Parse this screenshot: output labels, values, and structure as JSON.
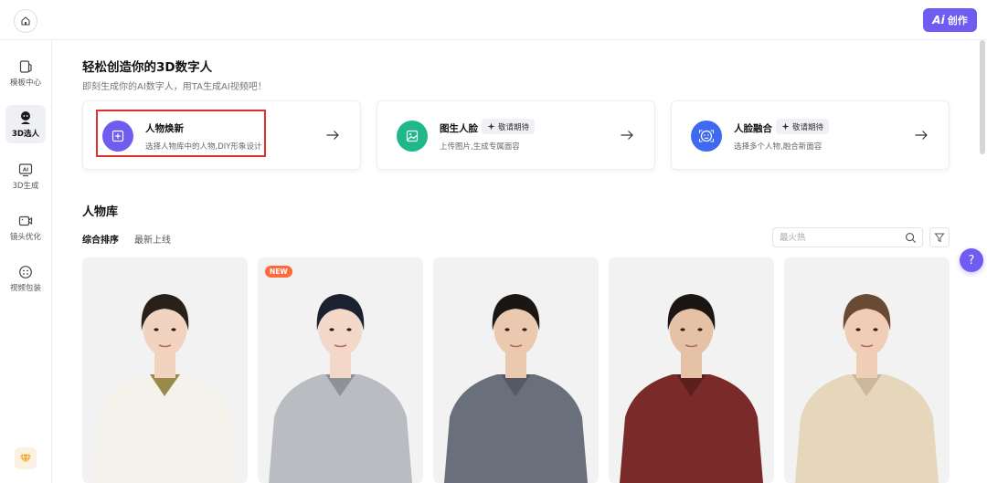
{
  "topbar": {
    "create_label": "创作",
    "create_ai": "Ai"
  },
  "sidebar": {
    "items": [
      {
        "label": "模板中心",
        "icon": "template-icon"
      },
      {
        "label": "3D选人",
        "icon": "person-icon",
        "active": true
      },
      {
        "label": "3D生成",
        "icon": "ai-generate-icon"
      },
      {
        "label": "镜头优化",
        "icon": "camera-icon"
      },
      {
        "label": "视频包装",
        "icon": "package-icon"
      }
    ],
    "bottom_icon": "diamond-icon"
  },
  "header": {
    "title": "轻松创造你的3D数字人",
    "subtitle": "即刻生成你的AI数字人，用TA生成AI视频吧！"
  },
  "features": [
    {
      "title": "人物焕新",
      "desc": "选择人物库中的人物,DIY形象设计",
      "icon": "plus-square-icon",
      "color": "#6f5cf0",
      "badge": ""
    },
    {
      "title": "图生人脸",
      "desc": "上传图片,生成专属面容",
      "icon": "image-icon",
      "color": "#1fb88a",
      "badge": "敬请期待"
    },
    {
      "title": "人脸融合",
      "desc": "选择多个人物,融合新面容",
      "icon": "face-merge-icon",
      "color": "#3d6af0",
      "badge": "敬请期待"
    }
  ],
  "library": {
    "title": "人物库",
    "sort_tabs": [
      "综合排序",
      "最新上线"
    ],
    "search_placeholder": "最火热",
    "new_badge": "NEW",
    "characters": [
      {
        "hair": "#2a201a",
        "skin": "#f1d3c0",
        "outfit": "#f4f2ea",
        "accent": "#9a8a4a"
      },
      {
        "hair": "#1c2130",
        "skin": "#f3d7c8",
        "outfit": "#b9bcc0",
        "accent": "#8e9196"
      },
      {
        "hair": "#1a1614",
        "skin": "#eac9ae",
        "outfit": "#6a6f7c",
        "accent": "#555966"
      },
      {
        "hair": "#1b1614",
        "skin": "#e5c2a6",
        "outfit": "#7a2a28",
        "accent": "#5c1f1d"
      },
      {
        "hair": "#6b4a34",
        "skin": "#f0cdb5",
        "outfit": "#e6d6bc",
        "accent": "#cbb898"
      }
    ]
  },
  "help_label": "?"
}
